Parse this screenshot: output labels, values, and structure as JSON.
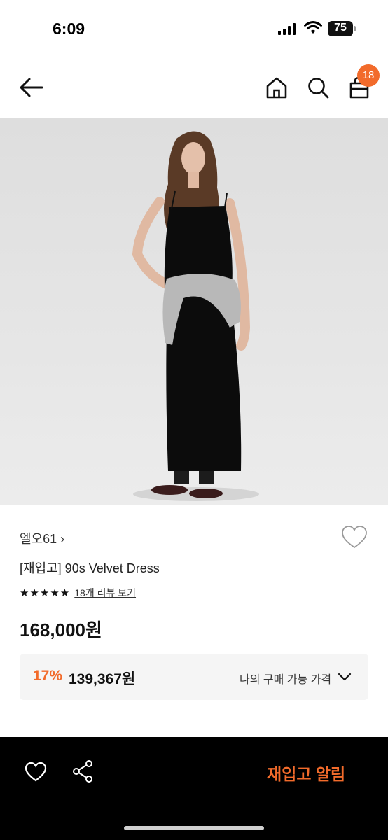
{
  "status": {
    "time": "6:09",
    "battery": "75"
  },
  "header": {
    "cart_count": "18"
  },
  "product": {
    "brand": "엘오61 ›",
    "name": "[재입고] 90s Velvet Dress",
    "stars": "★★★★★",
    "rating_value": 5,
    "review_link": "18개 리뷰 보기",
    "price": "168,000원",
    "discount_rate": "17%",
    "discount_price": "139,367원",
    "discount_label": "나의 구매 가능 가격"
  },
  "bottom_bar": {
    "restock_label": "재입고 알림"
  },
  "colors": {
    "accent": "#f26b2b",
    "bottom_bar_bg": "#000000",
    "discount_box_bg": "#f5f5f5"
  },
  "icons": [
    "back-arrow-icon",
    "home-icon",
    "search-icon",
    "cart-icon",
    "heart-icon",
    "share-icon",
    "chevron-down-icon"
  ]
}
